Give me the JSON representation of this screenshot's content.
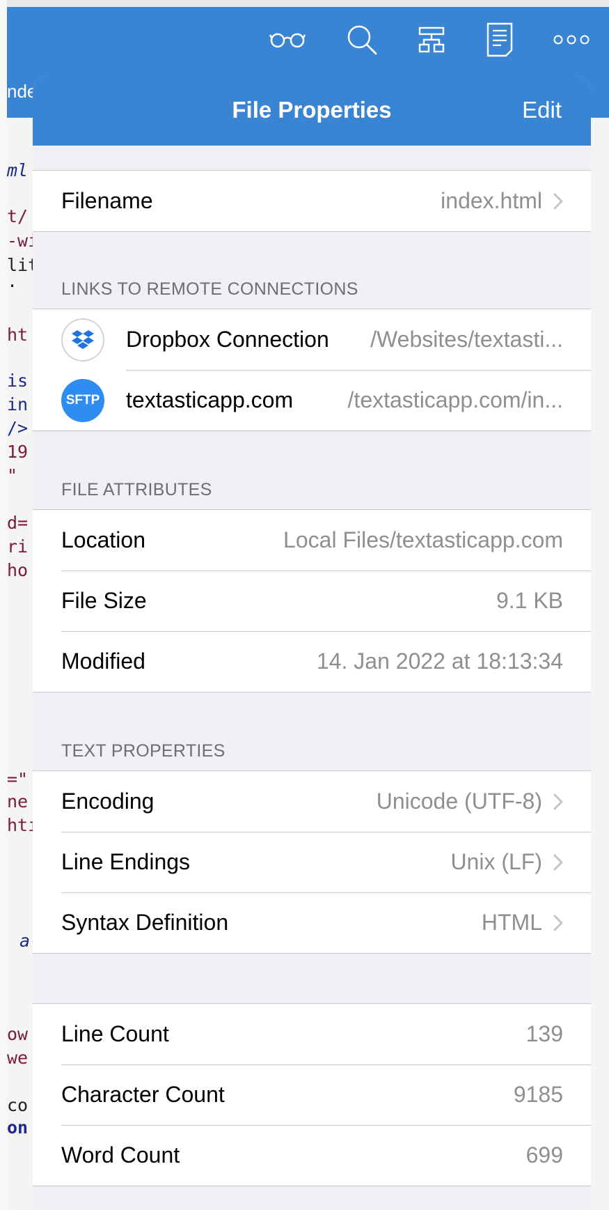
{
  "editor": {
    "tab_fragment": "nde",
    "code_fragments": [
      "ml",
      "t/",
      "-wi",
      "lit",
      "·",
      "ht",
      "is",
      "in",
      "/>",
      "19",
      "\"",
      "d=",
      "ri",
      "ho",
      "=\"",
      "ne",
      "htı",
      "a",
      "ow",
      "we",
      "co",
      "on"
    ]
  },
  "toolbar": {
    "icons": [
      "glasses-icon",
      "search-icon",
      "symbols-icon",
      "document-icon",
      "more-icon"
    ]
  },
  "popover": {
    "title": "File Properties",
    "edit_label": "Edit",
    "filename": {
      "label": "Filename",
      "value": "index.html"
    },
    "remote_header": "LINKS TO REMOTE CONNECTIONS",
    "connections": [
      {
        "icon": "dropbox-icon",
        "name": "Dropbox Connection",
        "path": "/Websites/textasti..."
      },
      {
        "icon": "sftp-icon",
        "icon_text": "SFTP",
        "name": "textasticapp.com",
        "path": "/textasticapp.com/in..."
      }
    ],
    "attributes_header": "FILE ATTRIBUTES",
    "attributes": [
      {
        "label": "Location",
        "value": "Local Files/textasticapp.com"
      },
      {
        "label": "File Size",
        "value": "9.1 KB"
      },
      {
        "label": "Modified",
        "value": "14. Jan 2022 at 18:13:34"
      }
    ],
    "text_header": "TEXT PROPERTIES",
    "text_properties": [
      {
        "label": "Encoding",
        "value": "Unicode (UTF-8)"
      },
      {
        "label": "Line Endings",
        "value": "Unix (LF)"
      },
      {
        "label": "Syntax Definition",
        "value": "HTML"
      }
    ],
    "counts": [
      {
        "label": "Line Count",
        "value": "139"
      },
      {
        "label": "Character Count",
        "value": "9185"
      },
      {
        "label": "Word Count",
        "value": "699"
      }
    ]
  },
  "colors": {
    "accent": "#3a85d3",
    "grouped_background": "#efeff4",
    "secondary_text": "#8e8e93",
    "sftp_badge": "#2f8cf0",
    "dropbox_blue": "#1f74e0",
    "code_navy": "#1b2a8c",
    "code_maroon": "#7a1c3a"
  }
}
